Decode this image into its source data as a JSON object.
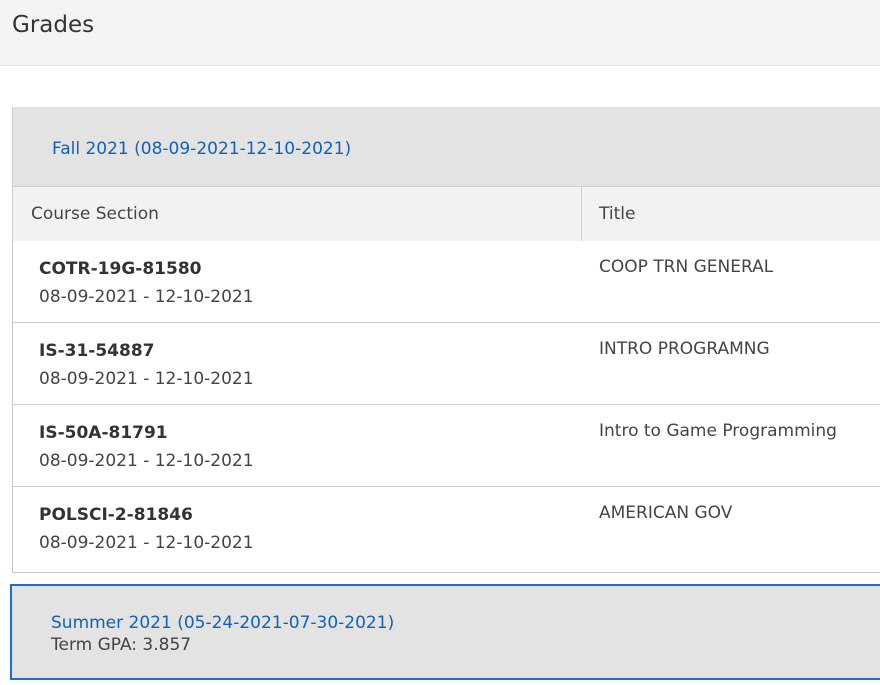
{
  "page": {
    "title": "Grades"
  },
  "terms": [
    {
      "label": "Fall 2021 (08-09-2021-12-10-2021)",
      "columns": {
        "course_section": "Course Section",
        "title": "Title"
      },
      "courses": [
        {
          "code": "COTR-19G-81580",
          "dates": "08-09-2021 - 12-10-2021",
          "title": "COOP TRN GENERAL"
        },
        {
          "code": "IS-31-54887",
          "dates": "08-09-2021 - 12-10-2021",
          "title": "INTRO PROGRAMNG"
        },
        {
          "code": "IS-50A-81791",
          "dates": "08-09-2021 - 12-10-2021",
          "title": "Intro to Game Programming"
        },
        {
          "code": "POLSCI-2-81846",
          "dates": "08-09-2021 - 12-10-2021",
          "title": "AMERICAN GOV"
        }
      ]
    },
    {
      "label": "Summer 2021 (05-24-2021-07-30-2021)",
      "gpa": "Term GPA: 3.857"
    }
  ],
  "colors": {
    "link": "#1361b7",
    "focus_border": "#1a6fd0",
    "panel_header": "#e3e3e3"
  }
}
